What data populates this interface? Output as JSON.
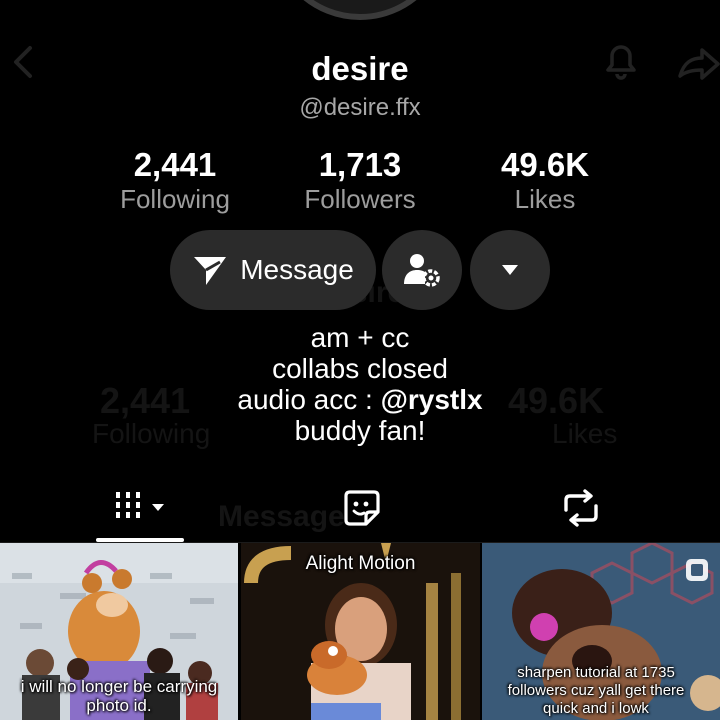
{
  "profile": {
    "display_name": "desire",
    "username": "@desire.ffx"
  },
  "stats": [
    {
      "value": "2,441",
      "label": "Following"
    },
    {
      "value": "1,713",
      "label": "Followers"
    },
    {
      "value": "49.6K",
      "label": "Likes"
    }
  ],
  "actions": {
    "message_label": "Message",
    "add_friend_icon": "person-gear-icon",
    "more_icon": "caret-down-icon"
  },
  "bio": {
    "lines": [
      "am + cc",
      "collabs closed",
      "audio acc : ",
      "buddy fan!"
    ],
    "mention": "@rystlx"
  },
  "tabs": [
    {
      "icon": "grid-icon",
      "selected": true
    },
    {
      "icon": "sticker-icon",
      "selected": false
    },
    {
      "icon": "repost-icon",
      "selected": false
    }
  ],
  "videos": [
    {
      "caption": "i will no longer be carrying photo id."
    },
    {
      "watermark": "Alight Motion"
    },
    {
      "caption": "sharpen tutorial at 1735 followers cuz yall get there quick and i lowk"
    }
  ],
  "ghost_overlay": {
    "name": "desire",
    "stat_left": "2,441",
    "stat_right": "49.6K",
    "label_left": "Following",
    "label_right": "Likes",
    "message": "Message"
  },
  "colors": {
    "background": "#000000",
    "button_bg": "#2b2b2b",
    "secondary_text": "#9d9d9d"
  }
}
